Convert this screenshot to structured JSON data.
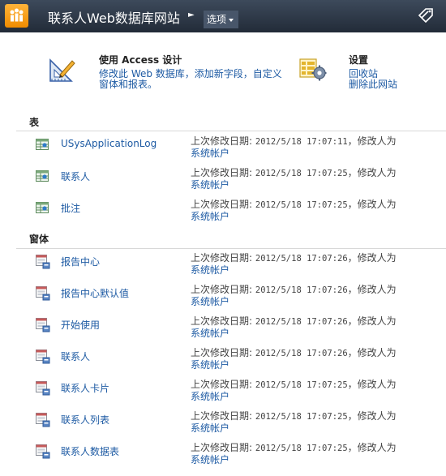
{
  "header": {
    "site_title": "联系人Web数据库网站",
    "options_label": "选项"
  },
  "quick_actions": {
    "access": {
      "title": "使用 Access 设计",
      "link_line1": "修改此 Web 数据库，添加新字段，自定义",
      "link_line2": "窗体和报表。"
    },
    "settings": {
      "title": "设置",
      "recycle": "回收站",
      "delete_site": "删除此网站"
    }
  },
  "sections": {
    "tables": {
      "title": "表",
      "items": [
        {
          "name": "USysApplicationLog",
          "modified_label": "上次修改日期:",
          "modified": "2012/5/18 17:07:11",
          "by_label": "，修改人为",
          "user": "系统帐户"
        },
        {
          "name": "联系人",
          "modified_label": "上次修改日期:",
          "modified": "2012/5/18 17:07:25",
          "by_label": "，修改人为",
          "user": "系统帐户"
        },
        {
          "name": "批注",
          "modified_label": "上次修改日期:",
          "modified": "2012/5/18 17:07:25",
          "by_label": "，修改人为",
          "user": "系统帐户"
        }
      ]
    },
    "forms": {
      "title": "窗体",
      "items": [
        {
          "name": "报告中心",
          "modified_label": "上次修改日期:",
          "modified": "2012/5/18 17:07:26",
          "by_label": "，修改人为",
          "user": "系统帐户"
        },
        {
          "name": "报告中心默认值",
          "modified_label": "上次修改日期:",
          "modified": "2012/5/18 17:07:26",
          "by_label": "，修改人为",
          "user": "系统帐户"
        },
        {
          "name": "开始使用",
          "modified_label": "上次修改日期:",
          "modified": "2012/5/18 17:07:26",
          "by_label": "，修改人为",
          "user": "系统帐户"
        },
        {
          "name": "联系人",
          "modified_label": "上次修改日期:",
          "modified": "2012/5/18 17:07:26",
          "by_label": "，修改人为",
          "user": "系统帐户"
        },
        {
          "name": "联系人卡片",
          "modified_label": "上次修改日期:",
          "modified": "2012/5/18 17:07:25",
          "by_label": "，修改人为",
          "user": "系统帐户"
        },
        {
          "name": "联系人列表",
          "modified_label": "上次修改日期:",
          "modified": "2012/5/18 17:07:25",
          "by_label": "，修改人为",
          "user": "系统帐户"
        },
        {
          "name": "联系人数据表",
          "modified_label": "上次修改日期:",
          "modified": "2012/5/18 17:07:25",
          "by_label": "，修改人为",
          "user": "系统帐户"
        }
      ]
    }
  }
}
